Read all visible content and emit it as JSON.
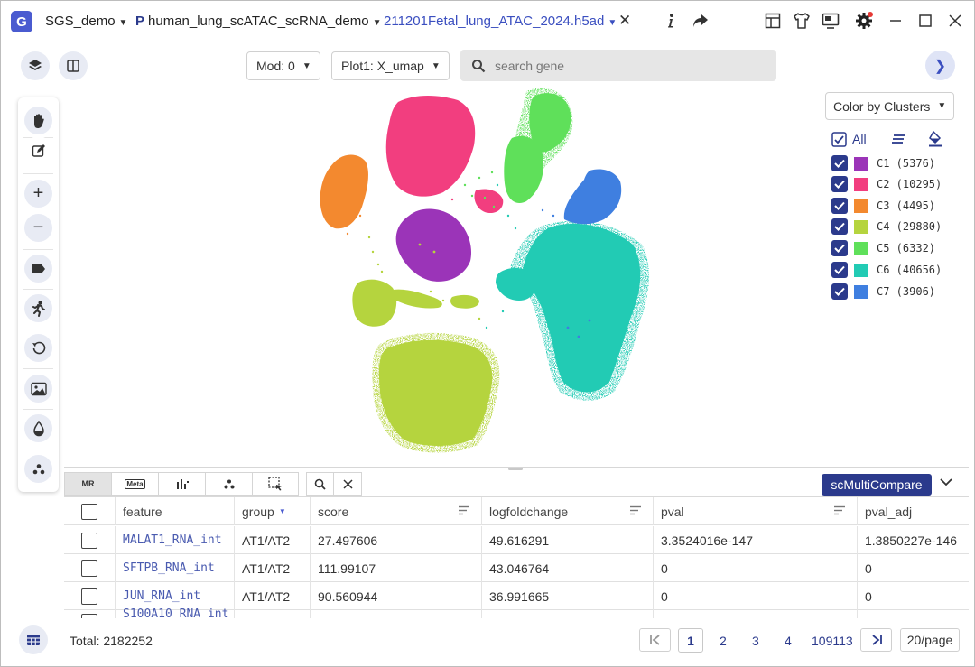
{
  "titlebar": {
    "app_name": "SGS_demo",
    "project": "human_lung_scATAC_scRNA_demo",
    "project_prefix": "P",
    "file_tab": "211201Fetal_lung_ATAC_2024.h5ad",
    "close_symbol": "✕"
  },
  "toolbar": {
    "mod_select": "Mod: 0",
    "plot_select": "Plot1: X_umap",
    "search_placeholder": "search gene"
  },
  "legend": {
    "color_by": "Color by Clusters",
    "all_label": "All",
    "items": [
      {
        "label": "C1 (5376)",
        "color": "#9b34b8"
      },
      {
        "label": "C2 (10295)",
        "color": "#f23e7f"
      },
      {
        "label": "C3 (4495)",
        "color": "#f3892f"
      },
      {
        "label": "C4 (29880)",
        "color": "#b5d43e"
      },
      {
        "label": "C5 (6332)",
        "color": "#5fe05a"
      },
      {
        "label": "C6 (40656)",
        "color": "#22cbb4"
      },
      {
        "label": "C7 (3906)",
        "color": "#3f7fe0"
      }
    ]
  },
  "bottom_panel": {
    "tabs": [
      "MR",
      "Meta"
    ],
    "multi_compare_button": "scMultiCompare"
  },
  "table": {
    "columns": [
      "feature",
      "group",
      "score",
      "logfoldchange",
      "pval",
      "pval_adj"
    ],
    "rows": [
      {
        "feature": "MALAT1_RNA_int",
        "group": "AT1/AT2",
        "score": "27.497606",
        "logfoldchange": "49.616291",
        "pval": "3.3524016e-147",
        "pval_adj": "1.3850227e-146"
      },
      {
        "feature": "SFTPB_RNA_int",
        "group": "AT1/AT2",
        "score": "111.99107",
        "logfoldchange": "43.046764",
        "pval": "0",
        "pval_adj": "0"
      },
      {
        "feature": "JUN_RNA_int",
        "group": "AT1/AT2",
        "score": "90.560944",
        "logfoldchange": "36.991665",
        "pval": "0",
        "pval_adj": "0"
      },
      {
        "feature": "S100A10_RNA_int",
        "group": "",
        "score": "",
        "logfoldchange": "",
        "pval": "",
        "pval_adj": ""
      }
    ]
  },
  "footer": {
    "total": "Total: 2182252",
    "pages": [
      "1",
      "2",
      "3",
      "4",
      "109113"
    ],
    "current_page": "1",
    "page_size": "20/page"
  }
}
